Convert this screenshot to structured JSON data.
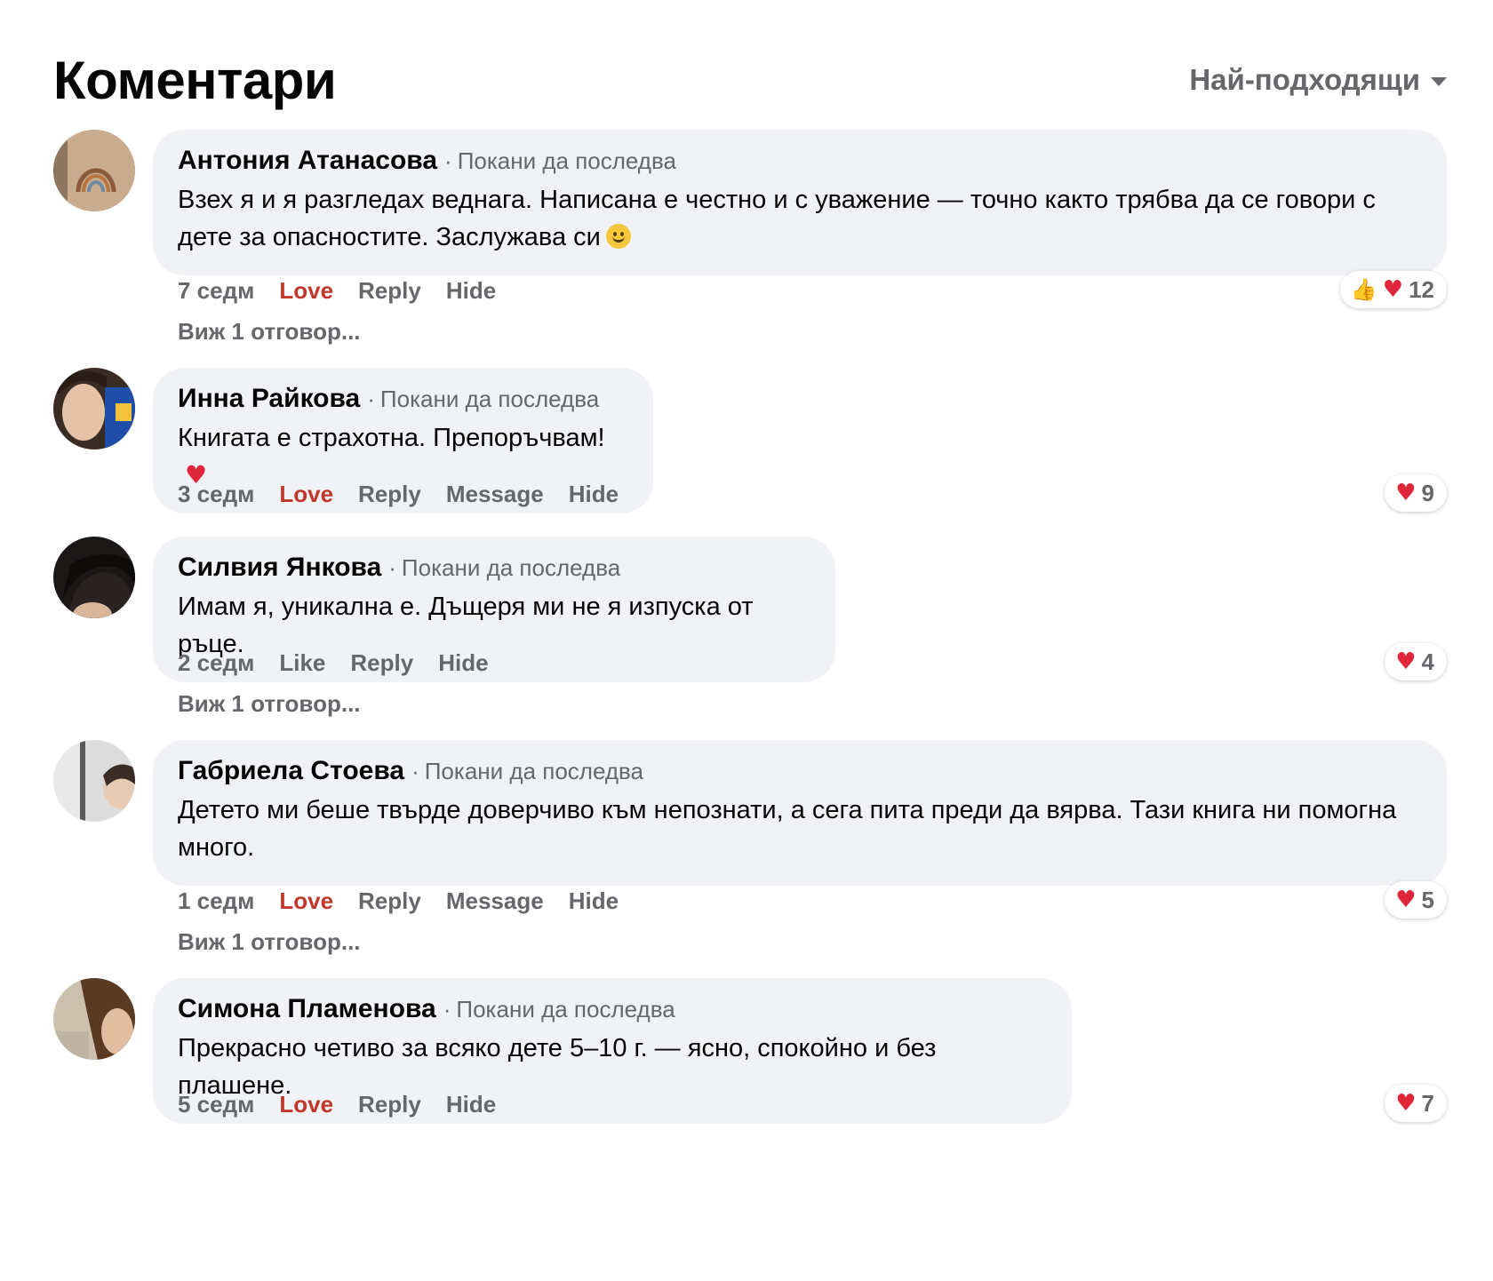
{
  "header": {
    "title": "Коментари",
    "sort_label": "Най-подходящи"
  },
  "comments": [
    {
      "author": "Антония Атанасова",
      "invite": "Покани да последва",
      "text": "Взех я и я разгледах веднага. Написана е честно и с уважение — точно както трябва да се говори с дете за опасностите. Заслужава си",
      "text_emoji": "smiling-face-icon",
      "time": "7 седм",
      "reaction_action": "Love",
      "reply": "Reply",
      "hide": "Hide",
      "reaction_icons": [
        "thumbs-up-icon",
        "heart-icon"
      ],
      "reaction_count": "12",
      "replies_link": "Виж 1 отговор..."
    },
    {
      "author": "Инна Райкова",
      "invite": "Покани да последва",
      "text": "Книгата е страхотна. Препоръчвам!",
      "text_emoji": "heart-icon",
      "time": "3 седм",
      "reaction_action": "Love",
      "reply": "Reply",
      "message": "Message",
      "hide": "Hide",
      "reaction_icons": [
        "heart-icon"
      ],
      "reaction_count": "9"
    },
    {
      "author": "Силвия Янкова",
      "invite": "Покани да последва",
      "text": "Имам я, уникална е. Дъщеря ми не я изпуска от ръце.",
      "time": "2 седм",
      "reaction_action": "Like",
      "reply": "Reply",
      "hide": "Hide",
      "reaction_icons": [
        "heart-icon"
      ],
      "reaction_count": "4",
      "replies_link": "Виж 1 отговор..."
    },
    {
      "author": "Габриела Стоева",
      "invite": "Покани да последва",
      "text": "Детето ми беше твърде доверчиво към непознати, а сега пита преди да вярва. Тази книга ни помогна много.",
      "time": "1 седм",
      "reaction_action": "Love",
      "reply": "Reply",
      "message": "Message",
      "hide": "Hide",
      "reaction_icons": [
        "heart-icon"
      ],
      "reaction_count": "5",
      "replies_link": "Виж 1 отговор..."
    },
    {
      "author": "Симона Пламенова",
      "invite": "Покани да последва",
      "text": "Прекрасно четиво за всяко дете 5–10 г. — ясно, спокойно и без плашене.",
      "time": "5 седм",
      "reaction_action": "Love",
      "reply": "Reply",
      "hide": "Hide",
      "reaction_icons": [
        "heart-icon"
      ],
      "reaction_count": "7"
    }
  ],
  "colors": {
    "bubble": "#f0f2f5",
    "secondary_text": "#65676b",
    "love": "#c2372b",
    "heart": "#e0263a"
  }
}
